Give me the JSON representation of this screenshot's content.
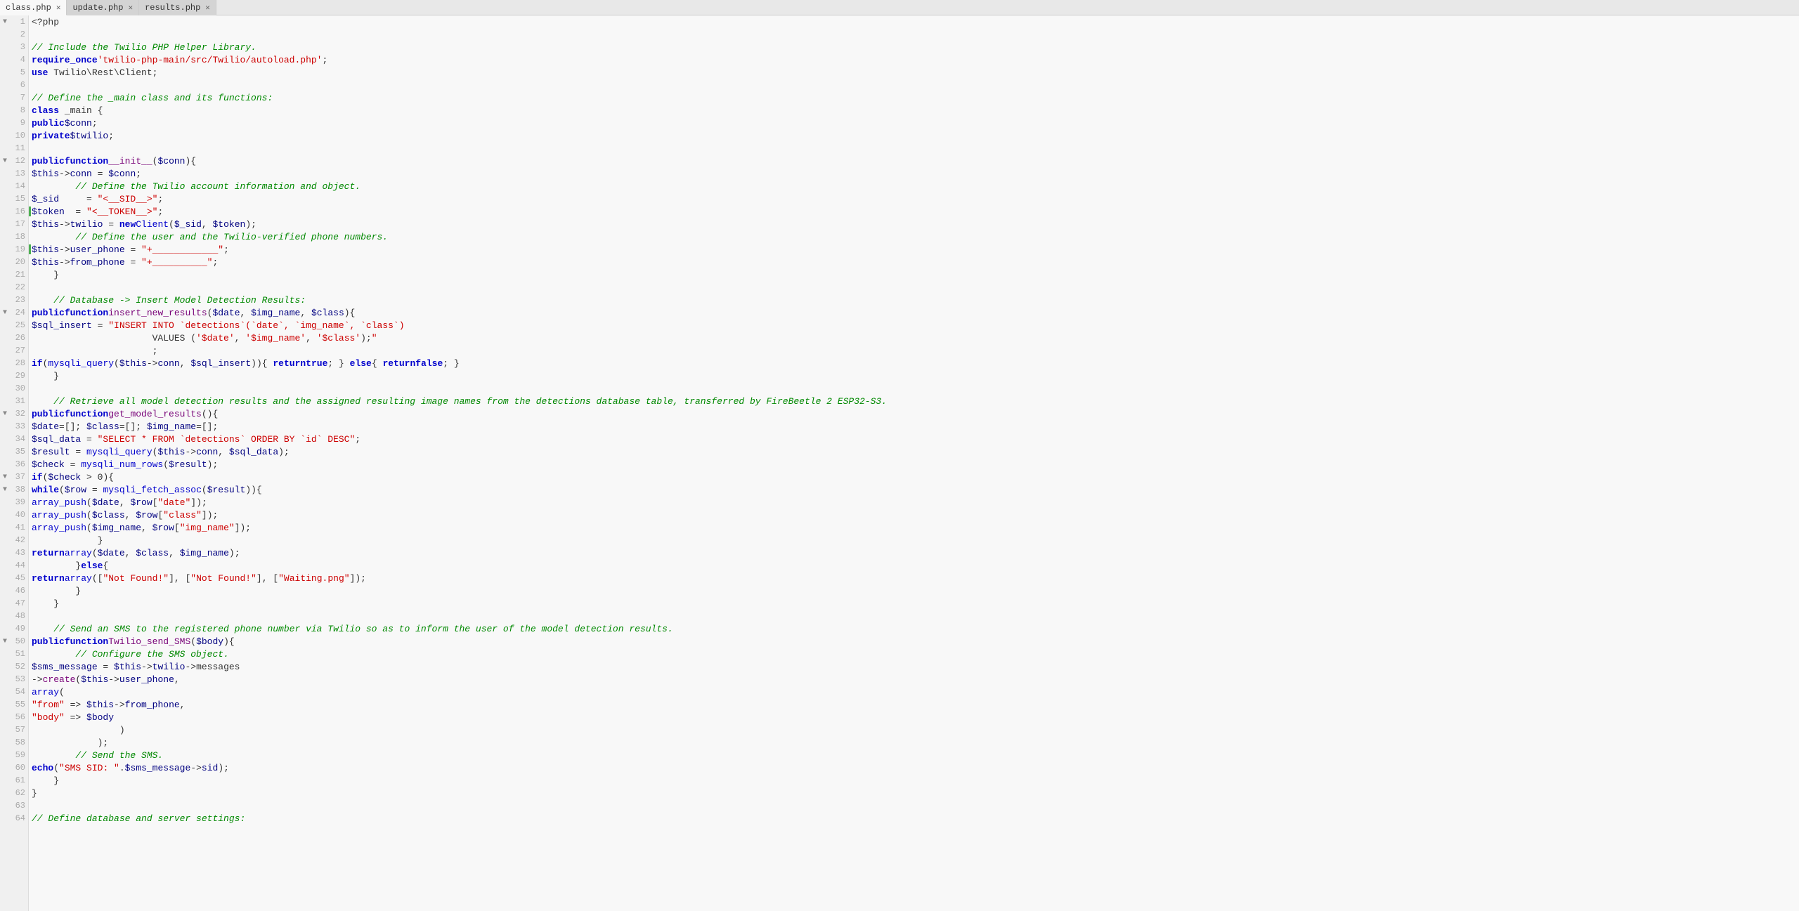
{
  "tabs": [
    {
      "label": "class.php",
      "active": true,
      "closeable": true
    },
    {
      "label": "update.php",
      "active": false,
      "closeable": true
    },
    {
      "label": "results.php",
      "active": false,
      "closeable": true
    }
  ],
  "colors": {
    "keyword": "#0000cc",
    "string": "#cc0000",
    "comment": "#008800",
    "variable": "#000080",
    "function": "#770077",
    "background": "#f8f8f8",
    "gutter": "#f0f0f0",
    "marker": "#4CAF50"
  },
  "lines": [
    {
      "num": 1,
      "fold": true,
      "content": "<?php",
      "marker": false
    },
    {
      "num": 2,
      "fold": false,
      "content": "",
      "marker": false
    },
    {
      "num": 3,
      "fold": false,
      "content": "// Include the Twilio PHP Helper Library.",
      "marker": false
    },
    {
      "num": 4,
      "fold": false,
      "content": "require_once 'twilio-php-main/src/Twilio/autoload.php';",
      "marker": false
    },
    {
      "num": 5,
      "fold": false,
      "content": "use Twilio\\Rest\\Client;",
      "marker": false
    },
    {
      "num": 6,
      "fold": false,
      "content": "",
      "marker": false
    },
    {
      "num": 7,
      "fold": false,
      "content": "// Define the _main class and its functions:",
      "marker": false
    },
    {
      "num": 8,
      "fold": false,
      "content": "class _main {",
      "marker": false
    },
    {
      "num": 9,
      "fold": false,
      "content": "    public $conn;",
      "marker": false
    },
    {
      "num": 10,
      "fold": false,
      "content": "    private $twilio;",
      "marker": false
    },
    {
      "num": 11,
      "fold": false,
      "content": "",
      "marker": false
    },
    {
      "num": 12,
      "fold": true,
      "content": "    public function __init__($conn){",
      "marker": false
    },
    {
      "num": 13,
      "fold": false,
      "content": "        $this->conn = $conn;",
      "marker": false
    },
    {
      "num": 14,
      "fold": false,
      "content": "        // Define the Twilio account information and object.",
      "marker": false
    },
    {
      "num": 15,
      "fold": false,
      "content": "        $_sid     = \"<__SID__>\";",
      "marker": false
    },
    {
      "num": 16,
      "fold": false,
      "content": "        $token  = \"<__TOKEN__>\";",
      "marker": true
    },
    {
      "num": 17,
      "fold": false,
      "content": "        $this->twilio = new Client($_sid, $token);",
      "marker": false
    },
    {
      "num": 18,
      "fold": false,
      "content": "        // Define the user and the Twilio-verified phone numbers.",
      "marker": false
    },
    {
      "num": 19,
      "fold": false,
      "content": "        $this->user_phone = \"+____________\";",
      "marker": true
    },
    {
      "num": 20,
      "fold": false,
      "content": "        $this->from_phone = \"+__________\";",
      "marker": false
    },
    {
      "num": 21,
      "fold": false,
      "content": "    }",
      "marker": false
    },
    {
      "num": 22,
      "fold": false,
      "content": "",
      "marker": false
    },
    {
      "num": 23,
      "fold": false,
      "content": "    // Database -> Insert Model Detection Results:",
      "marker": false
    },
    {
      "num": 24,
      "fold": true,
      "content": "    public function insert_new_results($date, $img_name, $class){",
      "marker": false
    },
    {
      "num": 25,
      "fold": false,
      "content": "        $sql_insert = \"INSERT INTO `detections`(`date`, `img_name`, `class`)",
      "marker": false
    },
    {
      "num": 26,
      "fold": false,
      "content": "                      VALUES ('$date', '$img_name', '$class');\"",
      "marker": false
    },
    {
      "num": 27,
      "fold": false,
      "content": "                      ;",
      "marker": false
    },
    {
      "num": 28,
      "fold": false,
      "content": "        if(mysqli_query($this->conn, $sql_insert)){ return true; } else{ return false; }",
      "marker": false
    },
    {
      "num": 29,
      "fold": false,
      "content": "    }",
      "marker": false
    },
    {
      "num": 30,
      "fold": false,
      "content": "",
      "marker": false
    },
    {
      "num": 31,
      "fold": false,
      "content": "    // Retrieve all model detection results and the assigned resulting image names from the detections database table, transferred by FireBeetle 2 ESP32-S3.",
      "marker": false
    },
    {
      "num": 32,
      "fold": true,
      "content": "    public function get_model_results(){",
      "marker": false
    },
    {
      "num": 33,
      "fold": false,
      "content": "        $date=[]; $class=[]; $img_name=[];",
      "marker": false
    },
    {
      "num": 34,
      "fold": false,
      "content": "        $sql_data = \"SELECT * FROM `detections` ORDER BY `id` DESC\";",
      "marker": false
    },
    {
      "num": 35,
      "fold": false,
      "content": "        $result = mysqli_query($this->conn, $sql_data);",
      "marker": false
    },
    {
      "num": 36,
      "fold": false,
      "content": "        $check = mysqli_num_rows($result);",
      "marker": false
    },
    {
      "num": 37,
      "fold": true,
      "content": "        if($check > 0){",
      "marker": false
    },
    {
      "num": 38,
      "fold": true,
      "content": "            while($row = mysqli_fetch_assoc($result)){",
      "marker": false
    },
    {
      "num": 39,
      "fold": false,
      "content": "                array_push($date, $row[\"date\"]);",
      "marker": false
    },
    {
      "num": 40,
      "fold": false,
      "content": "                array_push($class, $row[\"class\"]);",
      "marker": false
    },
    {
      "num": 41,
      "fold": false,
      "content": "                array_push($img_name, $row[\"img_name\"]);",
      "marker": false
    },
    {
      "num": 42,
      "fold": false,
      "content": "            }",
      "marker": false
    },
    {
      "num": 43,
      "fold": false,
      "content": "            return array($date, $class, $img_name);",
      "marker": false
    },
    {
      "num": 44,
      "fold": false,
      "content": "        }else{",
      "marker": false
    },
    {
      "num": 45,
      "fold": false,
      "content": "            return array([\"Not Found!\"], [\"Not Found!\"], [\"Waiting.png\"]);",
      "marker": false
    },
    {
      "num": 46,
      "fold": false,
      "content": "        }",
      "marker": false
    },
    {
      "num": 47,
      "fold": false,
      "content": "    }",
      "marker": false
    },
    {
      "num": 48,
      "fold": false,
      "content": "",
      "marker": false
    },
    {
      "num": 49,
      "fold": false,
      "content": "    // Send an SMS to the registered phone number via Twilio so as to inform the user of the model detection results.",
      "marker": false
    },
    {
      "num": 50,
      "fold": true,
      "content": "    public function Twilio_send_SMS($body){",
      "marker": false
    },
    {
      "num": 51,
      "fold": false,
      "content": "        // Configure the SMS object.",
      "marker": false
    },
    {
      "num": 52,
      "fold": false,
      "content": "        $sms_message = $this->twilio->messages",
      "marker": false
    },
    {
      "num": 53,
      "fold": false,
      "content": "            ->create($this->user_phone,",
      "marker": false
    },
    {
      "num": 54,
      "fold": false,
      "content": "                array(",
      "marker": false
    },
    {
      "num": 55,
      "fold": false,
      "content": "                    \"from\" => $this->from_phone,",
      "marker": false
    },
    {
      "num": 56,
      "fold": false,
      "content": "                    \"body\" => $body",
      "marker": false
    },
    {
      "num": 57,
      "fold": false,
      "content": "                )",
      "marker": false
    },
    {
      "num": 58,
      "fold": false,
      "content": "            );",
      "marker": false
    },
    {
      "num": 59,
      "fold": false,
      "content": "        // Send the SMS.",
      "marker": false
    },
    {
      "num": 60,
      "fold": false,
      "content": "        echo(\"SMS SID: \".$sms_message->sid);",
      "marker": false
    },
    {
      "num": 61,
      "fold": false,
      "content": "    }",
      "marker": false
    },
    {
      "num": 62,
      "fold": false,
      "content": "}",
      "marker": false
    },
    {
      "num": 63,
      "fold": false,
      "content": "",
      "marker": false
    },
    {
      "num": 64,
      "fold": false,
      "content": "// Define database and server settings:",
      "marker": false
    }
  ]
}
